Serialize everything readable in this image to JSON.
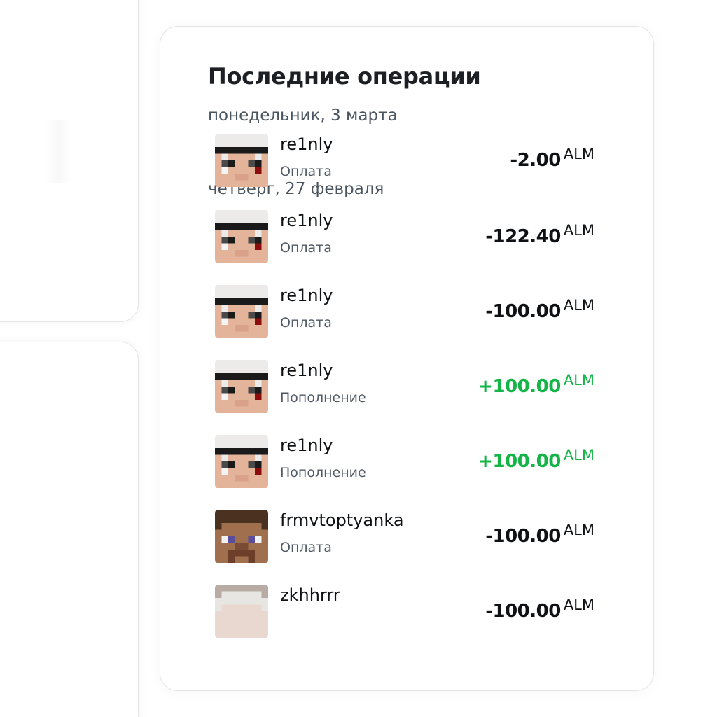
{
  "title": "Последние операции",
  "currency": "ALM",
  "colors": {
    "positive": "#14b447",
    "negative": "#0f1214"
  },
  "groups": [
    {
      "day": "понедельник, 3 марта",
      "transactions": [
        {
          "name": "re1nly",
          "type": "Оплата",
          "amount": "-2.00",
          "currency": "ALM",
          "direction": "negative",
          "avatar": "white-haired-skin-icon"
        }
      ]
    },
    {
      "day": "четверг, 27 февраля",
      "transactions": [
        {
          "name": "re1nly",
          "type": "Оплата",
          "amount": "-122.40",
          "currency": "ALM",
          "direction": "negative",
          "avatar": "white-haired-skin-icon"
        },
        {
          "name": "re1nly",
          "type": "Оплата",
          "amount": "-100.00",
          "currency": "ALM",
          "direction": "negative",
          "avatar": "white-haired-skin-icon"
        },
        {
          "name": "re1nly",
          "type": "Пополнение",
          "amount": "+100.00",
          "currency": "ALM",
          "direction": "positive",
          "avatar": "white-haired-skin-icon"
        },
        {
          "name": "re1nly",
          "type": "Пополнение",
          "amount": "+100.00",
          "currency": "ALM",
          "direction": "positive",
          "avatar": "white-haired-skin-icon"
        },
        {
          "name": "frmvtoptyanka",
          "type": "Оплата",
          "amount": "-100.00",
          "currency": "ALM",
          "direction": "negative",
          "avatar": "brown-haired-skin-icon"
        },
        {
          "name": "zkhhrrr",
          "type": "",
          "amount": "-100.00",
          "currency": "ALM",
          "direction": "negative",
          "avatar": "pale-skin-icon"
        }
      ]
    }
  ]
}
